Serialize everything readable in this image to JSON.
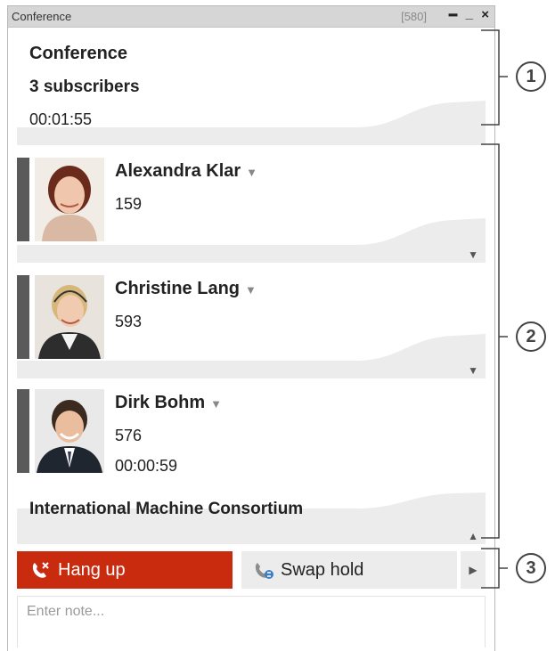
{
  "window": {
    "title": "Conference",
    "extension": "[580]"
  },
  "conference": {
    "title": "Conference",
    "subscribers": "3 subscribers",
    "duration": "00:01:55"
  },
  "participants": [
    {
      "name": "Alexandra Klar",
      "number": "159"
    },
    {
      "name": "Christine Lang",
      "number": "593"
    },
    {
      "name": "Dirk Bohm",
      "number": "576",
      "duration": "00:00:59",
      "company": "International Machine Consortium"
    }
  ],
  "actions": {
    "hang_up": "Hang up",
    "swap_hold": "Swap hold"
  },
  "note": {
    "placeholder": "Enter note..."
  },
  "callouts": [
    "1",
    "2",
    "3"
  ],
  "colors": {
    "hang_up": "#c92b0f",
    "accent_bar": "#5a5a5a",
    "panel": "#ececec"
  }
}
